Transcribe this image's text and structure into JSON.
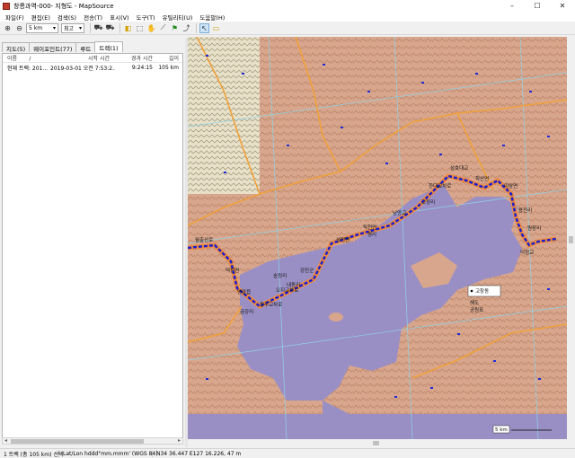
{
  "window": {
    "title": "창릉과역-000- 지형도 - MapSource",
    "controls": [
      "–",
      "☐",
      "✕"
    ]
  },
  "menu": [
    {
      "label": "파일(F)"
    },
    {
      "label": "편집(E)"
    },
    {
      "label": "검색(S)"
    },
    {
      "label": "전송(T)"
    },
    {
      "label": "표시(V)"
    },
    {
      "label": "도구(T)"
    },
    {
      "label": "유틸리티(U)"
    },
    {
      "label": "도움말(H)"
    }
  ],
  "toolbar": {
    "scale_value": "5 km",
    "detail_value": "최고",
    "accent": "#0078d7"
  },
  "left_panel": {
    "tabs": [
      "지도(5)",
      "웨이포인트(77)",
      "루트",
      "트랙(1)"
    ],
    "active_tab_index": 3,
    "columns": {
      "name": "이름",
      "sort": "/",
      "start": "시작 시간",
      "elapsed": "경과 시간",
      "length": "길이"
    },
    "rows": [
      {
        "name": "현재 트랙: 201...",
        "start": "2019-03-01 오전 7:53:2...",
        "elapsed": "9:24:15",
        "length": "105 km"
      }
    ]
  },
  "map": {
    "colors": {
      "land": "#d8a68d",
      "sea": "#9a8fc4",
      "grid": "#8fd3e8",
      "road": "#f0a13a",
      "track": "#1a1fd0",
      "track_edge": "#f08a3c",
      "unmapped": "#e8e0c8"
    },
    "labels": [
      "월출산로",
      "덕진면",
      "영암읍",
      "동무교차로",
      "오지교차로",
      "강진군",
      "성전면",
      "작천면",
      "남양교",
      "한대교차로",
      "삼호대교",
      "학산면",
      "미암면",
      "용전리",
      "원장리",
      "덕정교",
      "송정리",
      "내동리",
      "금강리",
      "평리",
      "고정리"
    ],
    "popup": {
      "title": "고창동",
      "line1": "해도",
      "line2": "공원표"
    },
    "scale": "5 km"
  },
  "status": {
    "track_info": "1 트랙 (총 105 km) 선택",
    "coord_format": "Lat/Lon hddd°mm.mmm' (WGS 84)",
    "position": "N34 36.447 E127 16.226, 47 m"
  }
}
